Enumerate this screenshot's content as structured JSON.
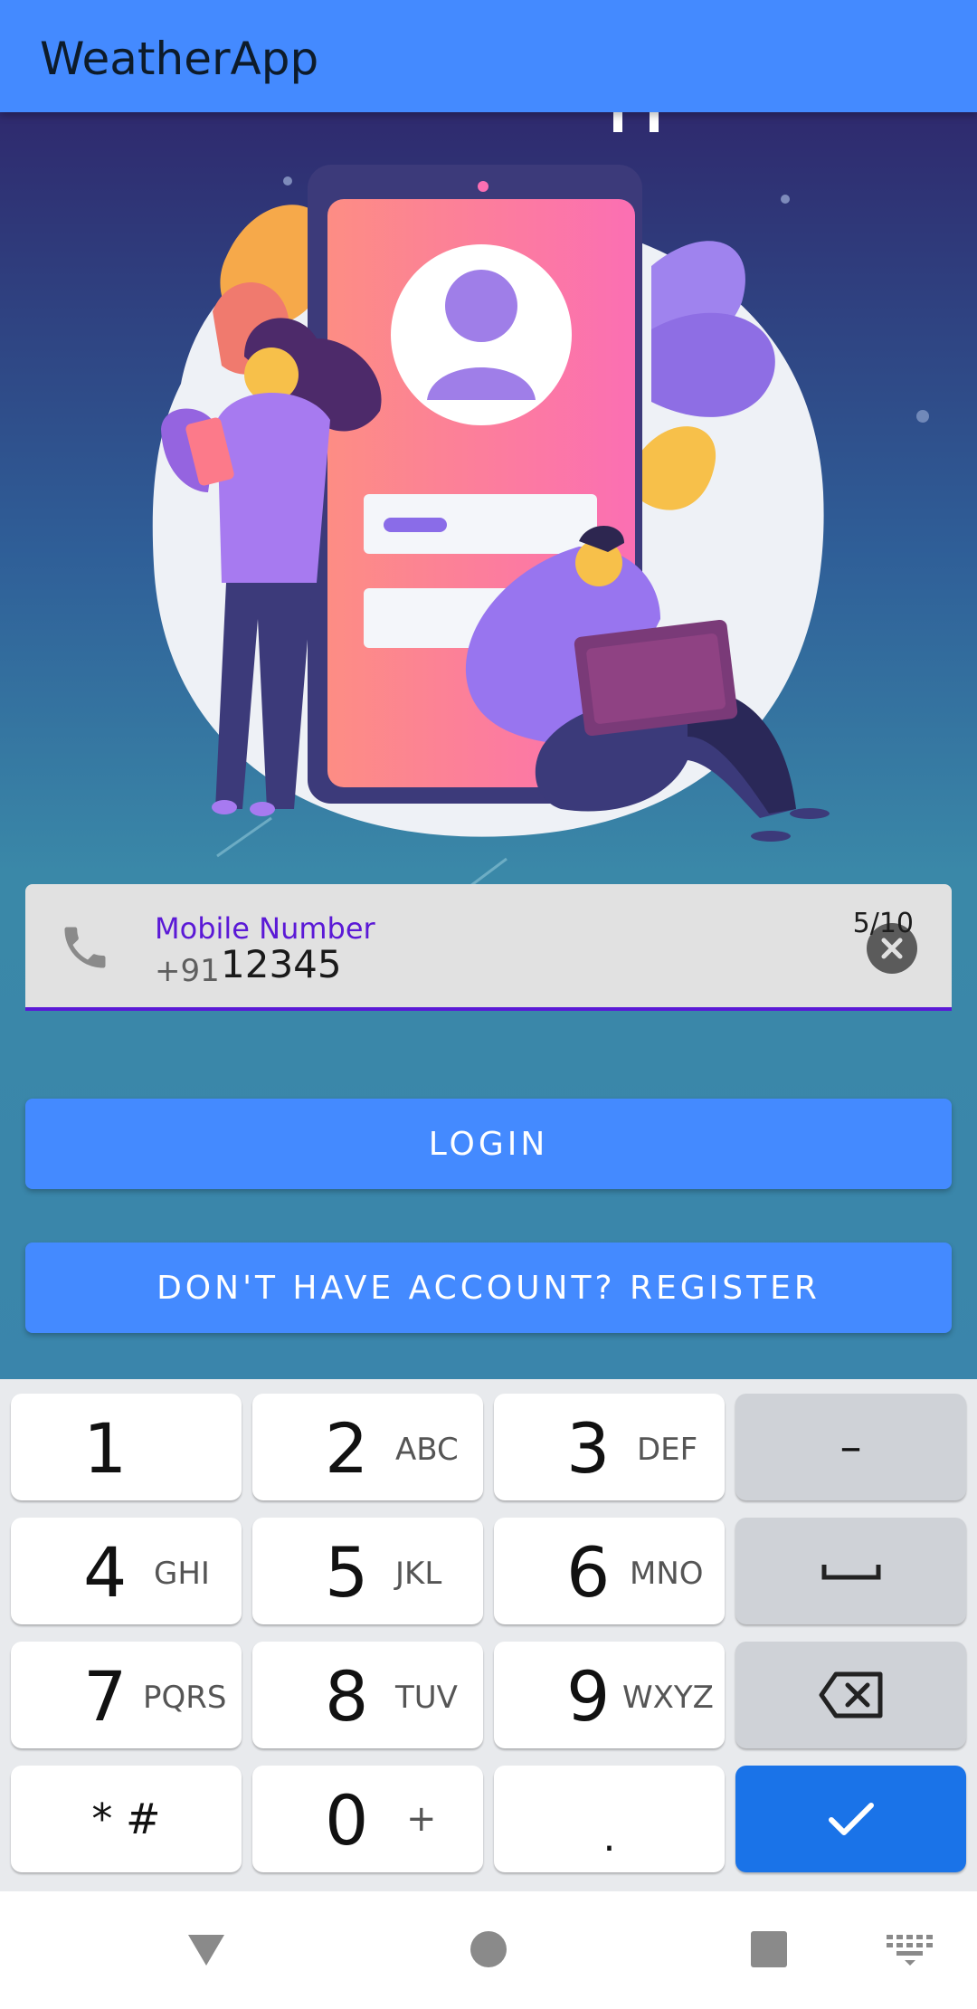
{
  "app": {
    "title": "WeatherApp"
  },
  "form": {
    "label": "Mobile Number",
    "prefix": "+91",
    "value": "12345",
    "counter": "5/10"
  },
  "buttons": {
    "login": "LOGIN",
    "register": "DON'T HAVE ACCOUNT? REGISTER"
  },
  "keyboard": {
    "keys": [
      {
        "main": "1",
        "sub": ""
      },
      {
        "main": "2",
        "sub": "ABC"
      },
      {
        "main": "3",
        "sub": "DEF"
      },
      {
        "main": "4",
        "sub": "GHI"
      },
      {
        "main": "5",
        "sub": "JKL"
      },
      {
        "main": "6",
        "sub": "MNO"
      },
      {
        "main": "7",
        "sub": "PQRS"
      },
      {
        "main": "8",
        "sub": "TUV"
      },
      {
        "main": "9",
        "sub": "WXYZ"
      },
      {
        "main": "0",
        "sub": "+"
      }
    ],
    "star_hash": "* #",
    "dot": ".",
    "dash": "–"
  },
  "colors": {
    "appbar": "#448AFF",
    "accent": "#5b19d6",
    "button": "#448AFF",
    "keyboard_enter": "#1a73e8"
  },
  "icons": {
    "field": "phone-icon",
    "clear": "close-circle-icon",
    "space": "space-icon",
    "backspace": "backspace-icon",
    "enter": "check-icon",
    "nav_back": "back-triangle-icon",
    "nav_home": "home-circle-icon",
    "nav_recents": "recents-square-icon",
    "keyboard_switch": "keyboard-icon"
  }
}
